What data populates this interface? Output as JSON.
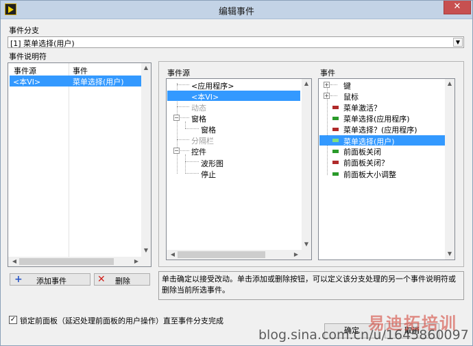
{
  "window": {
    "title": "编辑事件",
    "close_glyph": "✕"
  },
  "event_case": {
    "label": "事件分支",
    "value": "[1] 菜单选择(用户)"
  },
  "specifiers": {
    "label": "事件说明符",
    "col_source": "事件源",
    "col_event": "事件",
    "rows": [
      {
        "source": "<本VI>",
        "event": "菜单选择(用户)"
      }
    ]
  },
  "sources": {
    "label": "事件源",
    "items": [
      {
        "text": "<应用程序>",
        "dim": false
      },
      {
        "text": "<本VI>",
        "dim": false
      },
      {
        "text": "动态",
        "dim": true
      },
      {
        "text": "窗格",
        "dim": false
      },
      {
        "text": "窗格",
        "dim": false
      },
      {
        "text": "分隔栏",
        "dim": true
      },
      {
        "text": "控件",
        "dim": false
      },
      {
        "text": "波形图",
        "dim": false
      },
      {
        "text": "停止",
        "dim": false
      }
    ]
  },
  "events": {
    "label": "事件",
    "items": [
      {
        "text": "键",
        "icon": "folder"
      },
      {
        "text": "鼠标",
        "icon": "folder"
      },
      {
        "text": "菜单激活？",
        "icon": "filter"
      },
      {
        "text": "菜单选择(应用程序)",
        "icon": "notify"
      },
      {
        "text": "菜单选择？(应用程序)",
        "icon": "filter"
      },
      {
        "text": "菜单选择(用户)",
        "icon": "notify"
      },
      {
        "text": "前面板关闭",
        "icon": "notify"
      },
      {
        "text": "前面板关闭？",
        "icon": "filter"
      },
      {
        "text": "前面板大小调整",
        "icon": "notify"
      }
    ],
    "colors": {
      "filter": "#b02a2a",
      "notify": "#2a9a2a"
    }
  },
  "buttons": {
    "add_icon": "+",
    "add_label": "添加事件",
    "delete_icon": "✕",
    "delete_label": "删除",
    "ok_label": "确定",
    "cancel_label": "取消"
  },
  "description": "单击确定以接受改动。单击添加或删除按钮，可以定义该分支处理的另一个事件说明符或删除当前所选事件。",
  "lock_checkbox": {
    "checked_glyph": "✓",
    "label": "锁定前面板（延迟处理前面板的用户操作）直至事件分支完成"
  },
  "watermarks": {
    "brand": "易迪拓培训",
    "blog": "blog.sina.com.cn/u/1645860097"
  }
}
